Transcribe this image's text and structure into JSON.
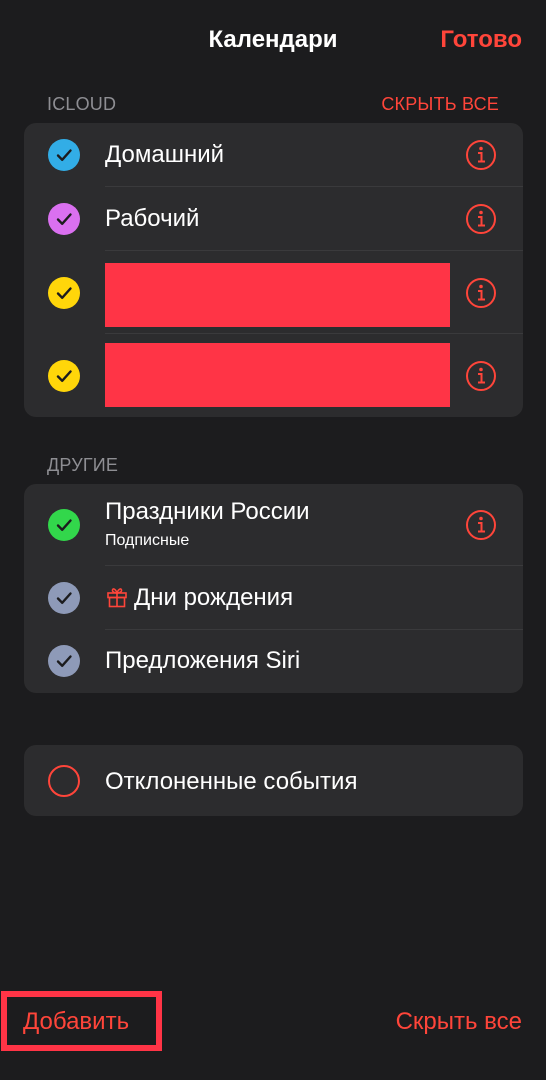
{
  "nav": {
    "title": "Календари",
    "done_label": "Готово"
  },
  "sections": {
    "icloud": {
      "header": "ICLOUD",
      "action": "СКРЫТЬ ВСЕ",
      "items": [
        {
          "label": "Домашний",
          "color": "#32ade6",
          "checked": true
        },
        {
          "label": "Рабочий",
          "color": "#da70f0",
          "checked": true
        },
        {
          "label": "",
          "color": "#ffd60a",
          "checked": true,
          "redacted": true
        },
        {
          "label": "",
          "color": "#ffd60a",
          "checked": true,
          "redacted": true
        }
      ]
    },
    "other": {
      "header": "ДРУГИЕ",
      "items": [
        {
          "label": "Праздники России",
          "sublabel": "Подписные",
          "color": "#32d74b",
          "checked": true
        },
        {
          "label": "Дни рождения",
          "icon": "gift-icon",
          "color": "#8e9ab8",
          "checked": true
        },
        {
          "label": "Предложения Siri",
          "color": "#8e9ab8",
          "checked": true
        }
      ]
    },
    "declined": {
      "items": [
        {
          "label": "Отклоненные события",
          "checked": false
        }
      ]
    }
  },
  "bottom": {
    "add_label": "Добавить",
    "hide_all_label": "Скрыть все"
  },
  "colors": {
    "accent": "#ff453a",
    "background": "#1c1c1e",
    "group": "#2c2c2e",
    "redaction": "#ff3446"
  }
}
